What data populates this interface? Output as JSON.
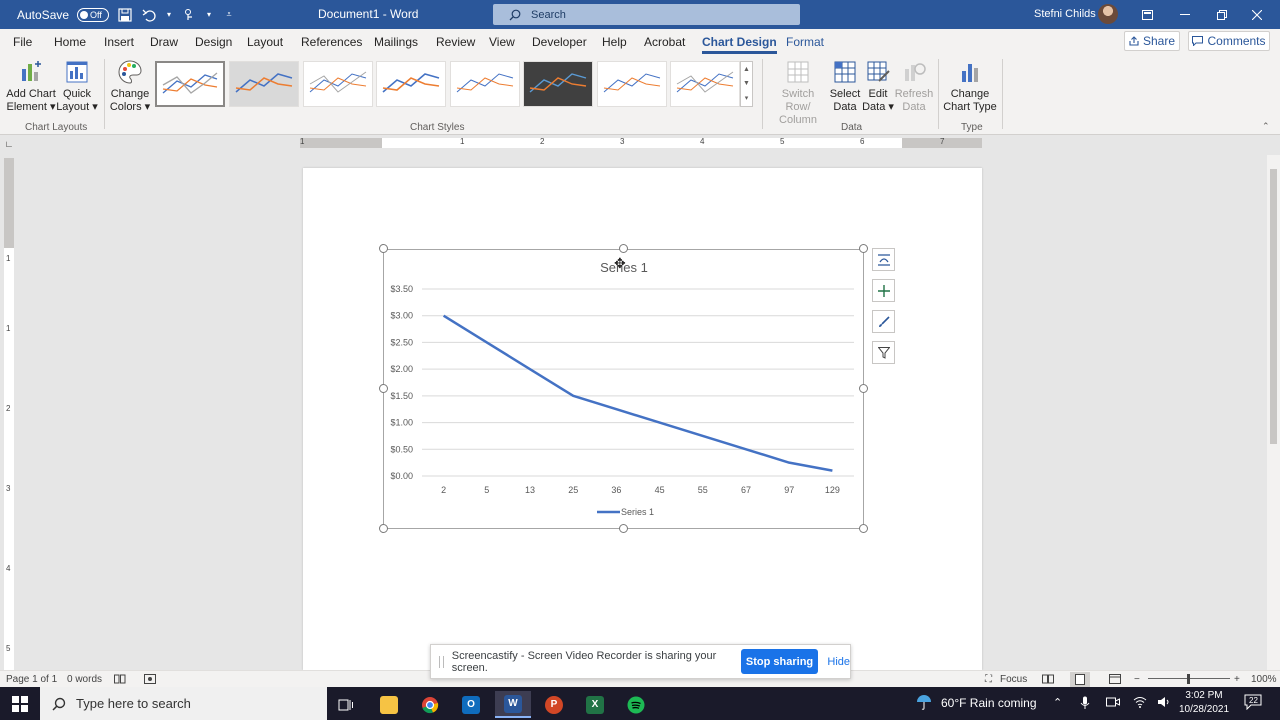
{
  "titlebar": {
    "autosave_label": "AutoSave",
    "autosave_state": "Off",
    "document_title": "Document1  -  Word",
    "search_placeholder": "Search",
    "user_name": "Stefni Childs"
  },
  "tabs": [
    "File",
    "Home",
    "Insert",
    "Draw",
    "Design",
    "Layout",
    "References",
    "Mailings",
    "Review",
    "View",
    "Developer",
    "Help",
    "Acrobat",
    "Chart Design",
    "Format"
  ],
  "share_label": "Share",
  "comments_label": "Comments",
  "ribbon": {
    "add_chart_element": [
      "Add Chart",
      "Element"
    ],
    "quick_layout": [
      "Quick",
      "Layout"
    ],
    "change_colors": [
      "Change",
      "Colors"
    ],
    "chart_layouts_label": "Chart Layouts",
    "chart_styles_label": "Chart Styles",
    "switch_row_column": [
      "Switch Row/",
      "Column"
    ],
    "select_data": [
      "Select",
      "Data"
    ],
    "edit_data": [
      "Edit",
      "Data"
    ],
    "refresh_data": [
      "Refresh",
      "Data"
    ],
    "data_label": "Data",
    "change_chart_type": [
      "Change",
      "Chart Type"
    ],
    "type_label": "Type"
  },
  "ruler_numbers": [
    "1",
    "1",
    "2",
    "3",
    "4",
    "5",
    "6",
    "7"
  ],
  "vruler_numbers": [
    "1",
    "1",
    "2",
    "3",
    "4",
    "5"
  ],
  "chart_data": {
    "type": "line",
    "title": "Series 1",
    "categories": [
      "2",
      "5",
      "13",
      "25",
      "36",
      "45",
      "55",
      "67",
      "97",
      "129"
    ],
    "series": [
      {
        "name": "Series 1",
        "values": [
          3.0,
          2.5,
          2.0,
          1.5,
          1.25,
          1.0,
          0.75,
          0.5,
          0.25,
          0.1
        ],
        "color": "#4472c4"
      }
    ],
    "y_ticks": [
      "$0.00",
      "$0.50",
      "$1.00",
      "$1.50",
      "$2.00",
      "$2.50",
      "$3.00",
      "$3.50"
    ],
    "ylim": [
      0,
      3.5
    ],
    "grid": true,
    "legend": "bottom"
  },
  "statusbar": {
    "page": "Page 1 of 1",
    "words": "0 words",
    "focus": "Focus",
    "zoom": "100%"
  },
  "banner": {
    "message": "Screencastify - Screen Video Recorder is sharing your screen.",
    "stop_label": "Stop sharing",
    "hide_label": "Hide"
  },
  "taskbar": {
    "search_placeholder": "Type here to search",
    "weather": "60°F  Rain coming",
    "time": "3:02 PM",
    "date": "10/28/2021",
    "notifications": "22"
  }
}
